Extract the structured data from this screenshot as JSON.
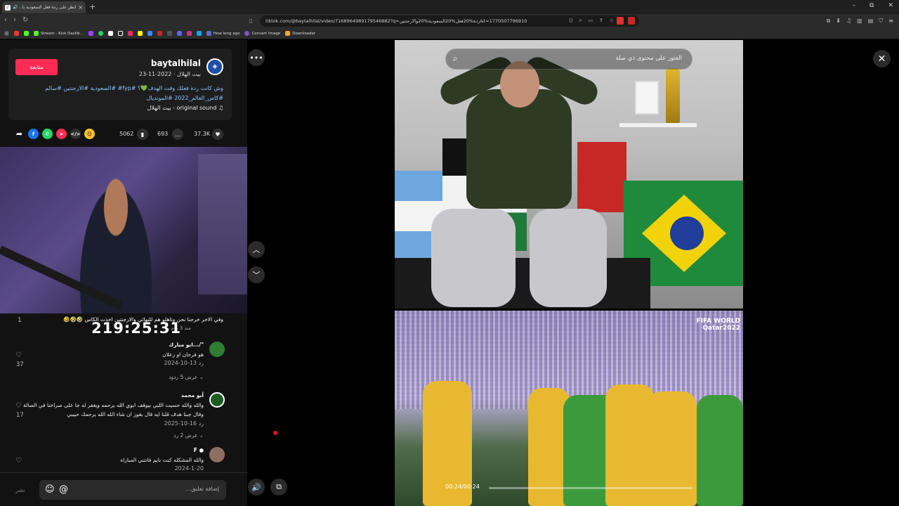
{
  "browser": {
    "tab_title": "انظر على ردة فعل السعودية با...",
    "tab_close": "×",
    "new_tab": "+",
    "url": "tiktok.com/@baytalhilal/video/7168964989179546882?q=ردة%20فعل%20السعودية%20والارجنتين&t=1770507796910",
    "bookmarks": [
      "Stream - Kick Dashb...",
      "How long ago",
      "Convert Image",
      "Downloader"
    ],
    "window_controls": [
      "–",
      "⧉",
      "✕"
    ]
  },
  "profile": {
    "follow_label": "متابعة",
    "username": "baytalhilal",
    "subtitle": "بيت الهلال · 2022-11-23",
    "caption_line1": "وش كانت ردة فعلك وقت الهدف💚؟ #fyp# #السعودية #الارجنتين #سالم",
    "caption_line2": "#كاس_العالم_2022 #المونديال",
    "sound": "original sound - بيت الهلال"
  },
  "stats": {
    "likes": "37.3K",
    "comments": "693",
    "saves": "5062"
  },
  "mini_video": {
    "timer": "219:25:31"
  },
  "comments": {
    "top_text": "وفي الاخر خرجنا نحن وتاهلو هم للنهائي والارجنتين اخذت الكاس 🤣🤣🤣",
    "top_meta": "منذ 3 يوم   رد",
    "top_count": "1",
    "items": [
      {
        "name": "ابو مبارك.../\"",
        "text": "هو فرحان او زعلان",
        "meta": "2024-10-13     رد",
        "likes": "37",
        "replies": "عرض 5 ردود ⌄"
      },
      {
        "name": "أبو محمد",
        "text": "والله والله حسيت اللبي بيوقف ابوي الله يرحمه ويغفر له جا على صراخنا في الصالة وقال جبنا هدف قلنا ايه قال بقوز ان شاء الله الله يرحمك حبيبي",
        "meta": "2025-10-16     رد",
        "likes": "17",
        "replies": "عرض 2 رد ⌄"
      },
      {
        "name": "F ●",
        "text": "والله المشكله كنت نايم فاتتني المباراه",
        "meta": "2024-1-20",
        "likes": "",
        "replies": ""
      }
    ]
  },
  "input": {
    "placeholder": "إضافة تعليق...",
    "post": "نشر"
  },
  "video": {
    "search_placeholder": "العثور على محتوى ذي صلة",
    "time": "00:24/00:24",
    "progress": 0.0,
    "logo_line1": "FIFA WORLD",
    "logo_line2": "Qatar2022"
  }
}
